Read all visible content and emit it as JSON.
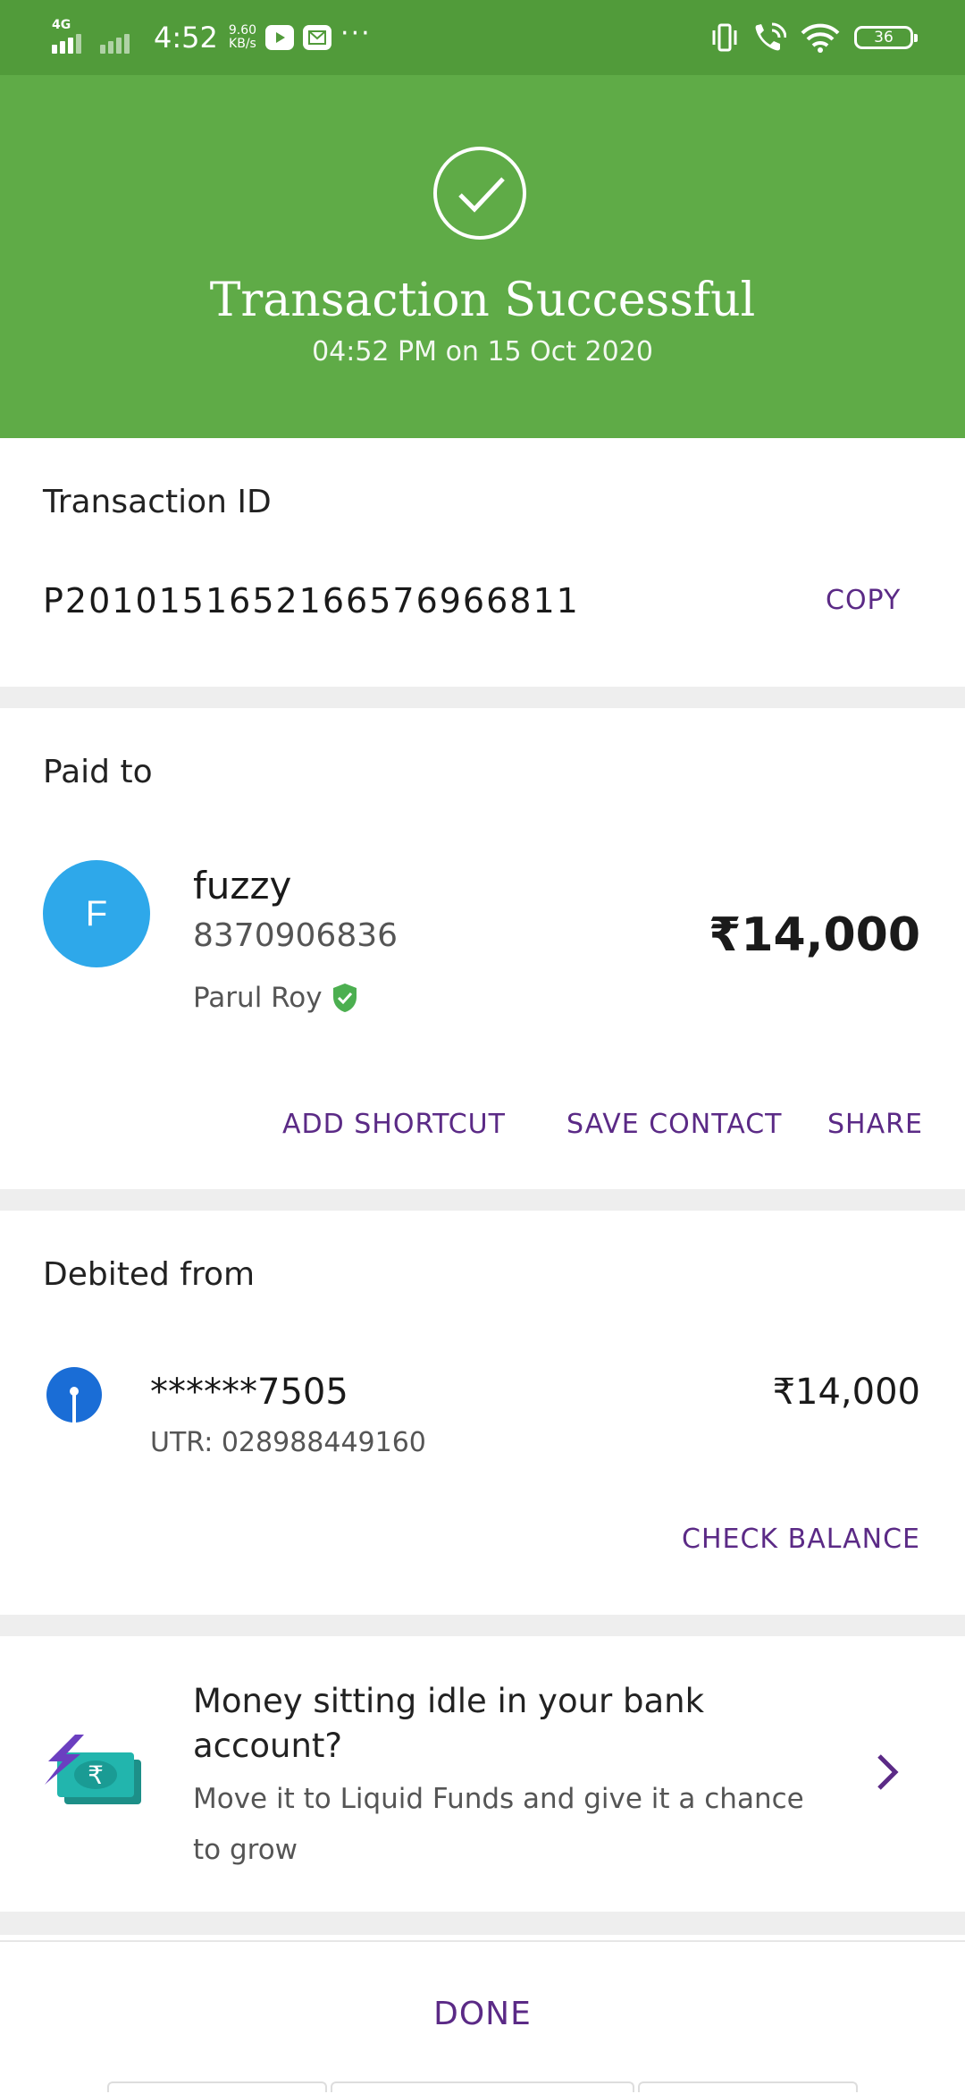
{
  "status_bar": {
    "network": "4G",
    "time": "4:52",
    "speed_value": "9.60",
    "speed_unit": "KB/s",
    "battery": "36"
  },
  "header": {
    "title": "Transaction Successful",
    "subtitle": "04:52 PM on 15 Oct 2020"
  },
  "transaction": {
    "id_label": "Transaction ID",
    "id_value": "P2010151652166576966811",
    "copy_label": "COPY"
  },
  "paid_to": {
    "section_label": "Paid to",
    "avatar_initial": "F",
    "name": "fuzzy",
    "phone": "8370906836",
    "registered_name": "Parul Roy",
    "amount": "₹14,000",
    "actions": {
      "add_shortcut": "ADD SHORTCUT",
      "save_contact": "SAVE CONTACT",
      "share": "SHARE"
    }
  },
  "debited_from": {
    "section_label": "Debited from",
    "account": "******7505",
    "utr": "UTR: 028988449160",
    "amount": "₹14,000",
    "check_balance": "CHECK BALANCE"
  },
  "promo": {
    "title": "Money sitting idle in your bank account?",
    "description": "Move it to Liquid Funds and give it a chance to grow"
  },
  "footer": {
    "done_label": "DONE"
  },
  "colors": {
    "status_bar": "#519b3a",
    "header": "#5fab47",
    "accent": "#5b2a86",
    "avatar": "#2ea8ea",
    "verified": "#4caf50",
    "bank": "#1a6dd6"
  }
}
